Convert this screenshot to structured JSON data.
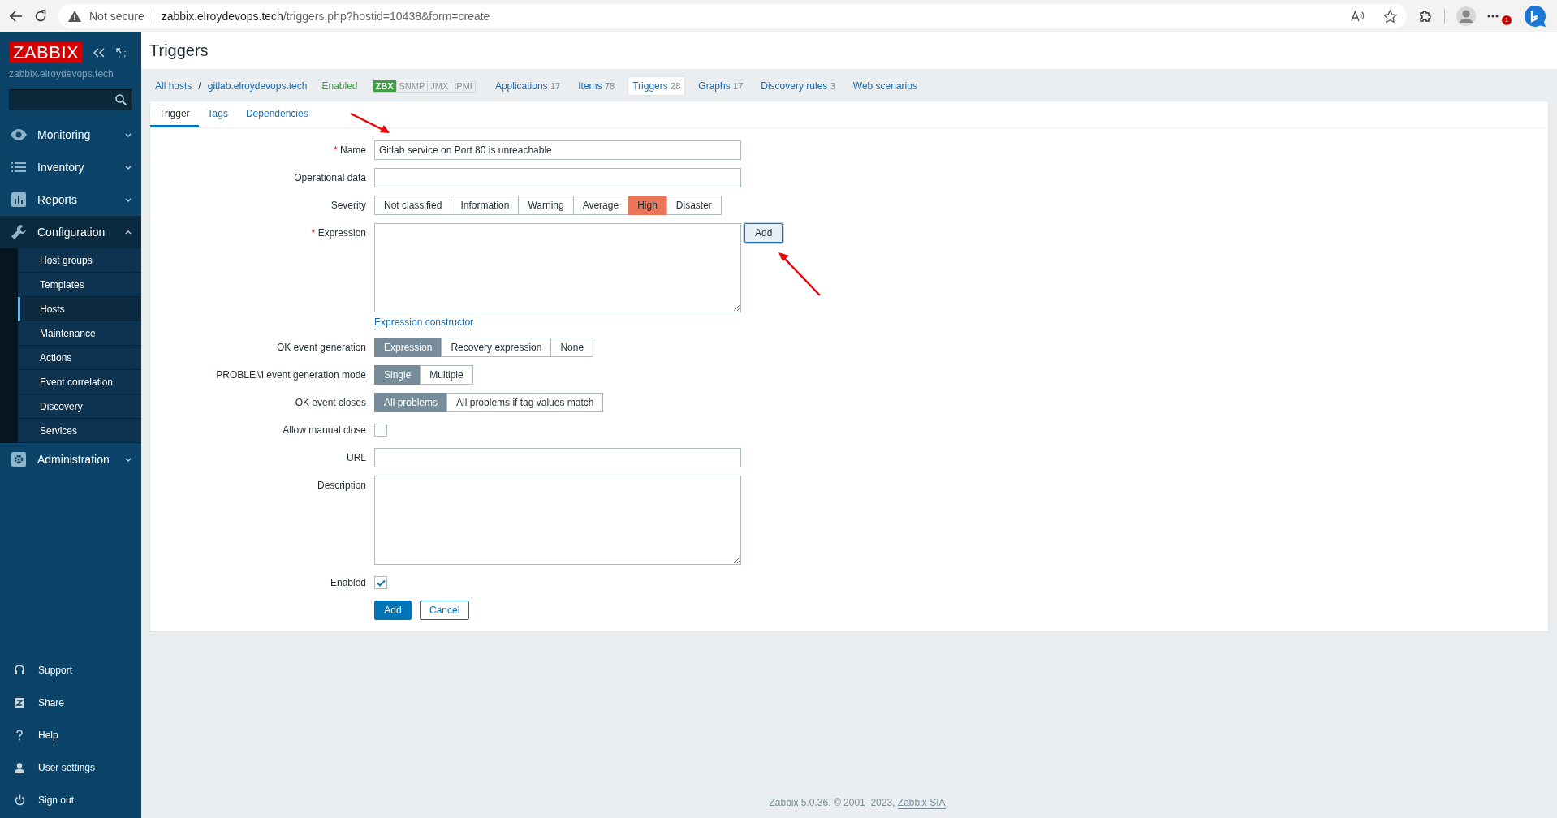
{
  "browser": {
    "security": "Not secure",
    "url_host": "zabbix.elroydevops.tech",
    "url_path": "/triggers.php?hostid=10438&form=create",
    "notification_count": "1"
  },
  "sidebar": {
    "logo": "ZABBIX",
    "server": "zabbix.elroydevops.tech",
    "menu": [
      {
        "label": "Monitoring",
        "expanded": false
      },
      {
        "label": "Inventory",
        "expanded": false
      },
      {
        "label": "Reports",
        "expanded": false
      },
      {
        "label": "Configuration",
        "expanded": true,
        "children": [
          {
            "label": "Host groups",
            "selected": false
          },
          {
            "label": "Templates",
            "selected": false
          },
          {
            "label": "Hosts",
            "selected": true
          },
          {
            "label": "Maintenance",
            "selected": false
          },
          {
            "label": "Actions",
            "selected": false
          },
          {
            "label": "Event correlation",
            "selected": false
          },
          {
            "label": "Discovery",
            "selected": false
          },
          {
            "label": "Services",
            "selected": false
          }
        ]
      },
      {
        "label": "Administration",
        "expanded": false
      }
    ],
    "bottom": [
      "Support",
      "Share",
      "Help",
      "User settings",
      "Sign out"
    ]
  },
  "page_title": "Triggers",
  "required_marker": "*",
  "host_nav": {
    "breadcrumbs": [
      "All hosts",
      "gitlab.elroydevops.tech"
    ],
    "separator": "/",
    "status": "Enabled",
    "availability": [
      {
        "label": "ZBX",
        "on": true
      },
      {
        "label": "SNMP",
        "on": false
      },
      {
        "label": "JMX",
        "on": false
      },
      {
        "label": "IPMI",
        "on": false
      }
    ],
    "links": [
      {
        "label": "Applications",
        "count": "17",
        "selected": false
      },
      {
        "label": "Items",
        "count": "78",
        "selected": false
      },
      {
        "label": "Triggers",
        "count": "28",
        "selected": true
      },
      {
        "label": "Graphs",
        "count": "17",
        "selected": false
      },
      {
        "label": "Discovery rules",
        "count": "3",
        "selected": false
      },
      {
        "label": "Web scenarios",
        "selected": false
      }
    ]
  },
  "tabs": [
    {
      "label": "Trigger",
      "selected": true
    },
    {
      "label": "Tags",
      "selected": false
    },
    {
      "label": "Dependencies",
      "selected": false
    }
  ],
  "form": [
    {
      "kind": "text",
      "label": "Name",
      "required": true,
      "value": "Gitlab service on Port 80 is unreachable"
    },
    {
      "kind": "text",
      "label": "Operational data",
      "required": false
    },
    {
      "kind": "severity",
      "label": "Severity",
      "options": [
        {
          "label": "Not classified",
          "selected": false
        },
        {
          "label": "Information",
          "selected": false
        },
        {
          "label": "Warning",
          "selected": false
        },
        {
          "label": "Average",
          "selected": false
        },
        {
          "label": "High",
          "selected": true
        },
        {
          "label": "Disaster",
          "selected": false
        }
      ]
    },
    {
      "kind": "expression",
      "label": "Expression",
      "required": true,
      "button": "Add"
    },
    {
      "kind": "link",
      "link": "Expression constructor"
    },
    {
      "kind": "radio",
      "label": "OK event generation",
      "options": [
        {
          "label": "Expression",
          "selected": true
        },
        {
          "label": "Recovery expression",
          "selected": false
        },
        {
          "label": "None",
          "selected": false
        }
      ]
    },
    {
      "kind": "radio",
      "label": "PROBLEM event generation mode",
      "options": [
        {
          "label": "Single",
          "selected": true
        },
        {
          "label": "Multiple",
          "selected": false
        }
      ]
    },
    {
      "kind": "radio",
      "label": "OK event closes",
      "options": [
        {
          "label": "All problems",
          "selected": true
        },
        {
          "label": "All problems if tag values match",
          "selected": false
        }
      ]
    },
    {
      "kind": "checkbox",
      "label": "Allow manual close",
      "checked": false
    },
    {
      "kind": "text",
      "label": "URL",
      "required": false
    },
    {
      "kind": "textarea",
      "label": "Description",
      "required": false
    },
    {
      "kind": "checkbox",
      "label": "Enabled",
      "checked": true
    }
  ],
  "actions": [
    {
      "label": "Add",
      "kind": "primary"
    },
    {
      "label": "Cancel",
      "kind": "secondary"
    }
  ],
  "footer": {
    "text": "Zabbix 5.0.36. © 2001–2023, ",
    "link": "Zabbix SIA"
  }
}
